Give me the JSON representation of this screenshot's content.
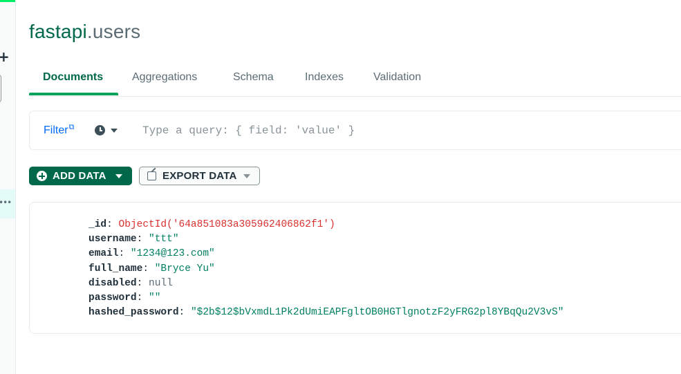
{
  "header": {
    "database": "fastapi",
    "separator": ".",
    "collection": "users"
  },
  "tabs": [
    {
      "label": "Documents",
      "active": true
    },
    {
      "label": "Aggregations",
      "active": false
    },
    {
      "label": "Schema",
      "active": false
    },
    {
      "label": "Indexes",
      "active": false
    },
    {
      "label": "Validation",
      "active": false
    }
  ],
  "filter": {
    "label": "Filter",
    "external_icon": "external-link-icon",
    "history_icon": "clock-icon",
    "placeholder": "Type a query: { field: 'value' }",
    "value": ""
  },
  "toolbar": {
    "add_data_label": "ADD DATA",
    "export_data_label": "EXPORT DATA"
  },
  "document": {
    "fields": [
      {
        "key": "_id",
        "value": "ObjectId('64a851083a305962406862f1')",
        "type": "objectid"
      },
      {
        "key": "username",
        "value": "\"ttt\"",
        "type": "string"
      },
      {
        "key": "email",
        "value": "\"1234@123.com\"",
        "type": "string"
      },
      {
        "key": "full_name",
        "value": "\"Bryce Yu\"",
        "type": "string"
      },
      {
        "key": "disabled",
        "value": "null",
        "type": "null"
      },
      {
        "key": "password",
        "value": "\"\"",
        "type": "string"
      },
      {
        "key": "hashed_password",
        "value": "\"$2b$12$bVxmdL1Pk2dUmiEAPFgltOB0HGTlgnotzF2yFRG2pl8YBqQu2V3vS\"",
        "type": "string"
      }
    ]
  },
  "colors": {
    "brand_green": "#00684a",
    "accent_green": "#00ed64",
    "link_blue": "#016bf8",
    "objectid_red": "#db3030",
    "string_green": "#008060"
  }
}
